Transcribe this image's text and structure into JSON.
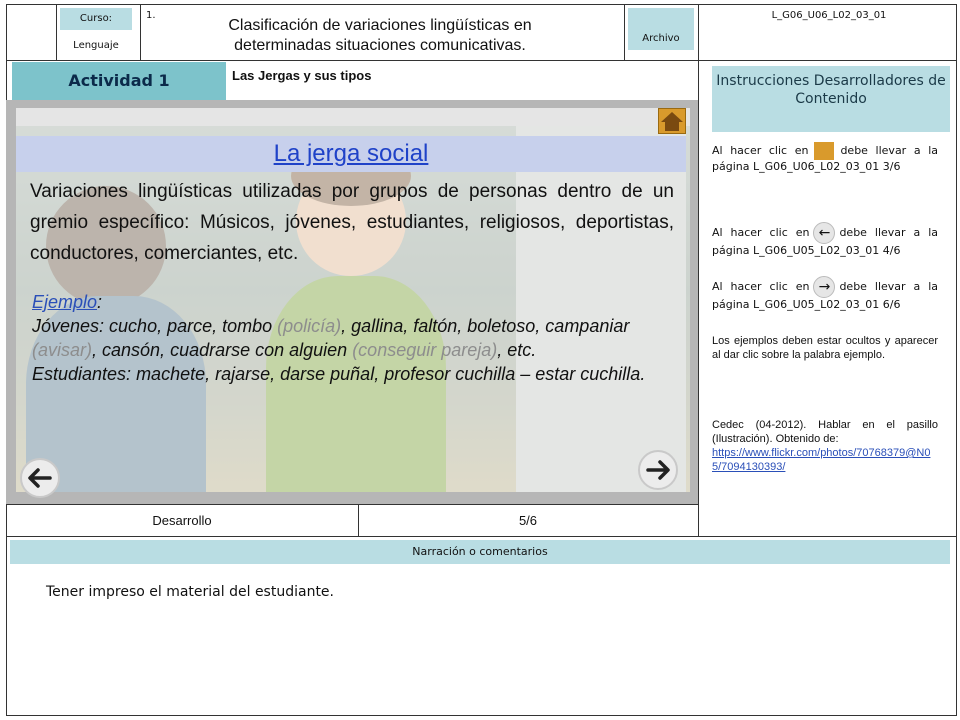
{
  "header": {
    "curso_label": "Curso:",
    "course": "Lenguaje",
    "number": "1.",
    "title": "Clasificación de variaciones lingüísticas en determinadas situaciones comunicativas.",
    "archivo_label": "Archivo",
    "file_code": "L_G06_U06_L02_03_01"
  },
  "activity": {
    "tab_label": "Actividad 1",
    "subtitle": "Las Jergas y sus tipos"
  },
  "slide": {
    "title": "La jerga social",
    "description": "Variaciones lingüísticas utilizadas por grupos de personas dentro de un gremio específico: Músicos, jóvenes, estudiantes, religiosos, deportistas, conductores, comerciantes, etc.",
    "ejemplo_link": "Ejemplo",
    "ejemplo_colon": ":",
    "jovenes_1": "Jóvenes: cucho, parce, tombo ",
    "jovenes_g1": "(policía)",
    "jovenes_2": ", gallina, faltón, boletoso, campaniar ",
    "jovenes_g2": "(avisar)",
    "jovenes_3": ", cansón, cuadrarse con alguien ",
    "jovenes_g3": "(conseguir pareja)",
    "jovenes_4": ", etc.",
    "estudiantes": "Estudiantes: machete, rajarse, darse puñal, profesor cuchilla – estar cuchilla.",
    "prev_arrow": "←",
    "next_arrow": "→"
  },
  "footer_row": {
    "section": "Desarrollo",
    "page": "5/6"
  },
  "right_panel": {
    "instructions_title": "Instrucciones Desarrolladores de Contenido",
    "home_pre": "Al hacer clic en",
    "home_post": "debe llevar a la página L_G06_U06_L02_03_01 3/6",
    "prev_pre": "Al hacer clic en",
    "prev_post": "debe llevar a la página L_G06_U05_L02_03_01 4/6",
    "next_pre": "Al hacer clic en",
    "next_post": "debe llevar a la página L_G06_U05_L02_03_01 6/6",
    "examples_note": "Los ejemplos deben estar ocultos y aparecer al dar clic sobre la palabra ejemplo.",
    "credit": "Cedec (04-2012). Hablar en el pasillo (Ilustración). Obtenido de:",
    "credit_url": "https://www.flickr.com/photos/70768379@N05/7094130393/",
    "arrow_left": "←",
    "arrow_right": "→"
  },
  "narration": {
    "label": "Narración o comentarios",
    "text": "Tener impreso el material del estudiante."
  }
}
